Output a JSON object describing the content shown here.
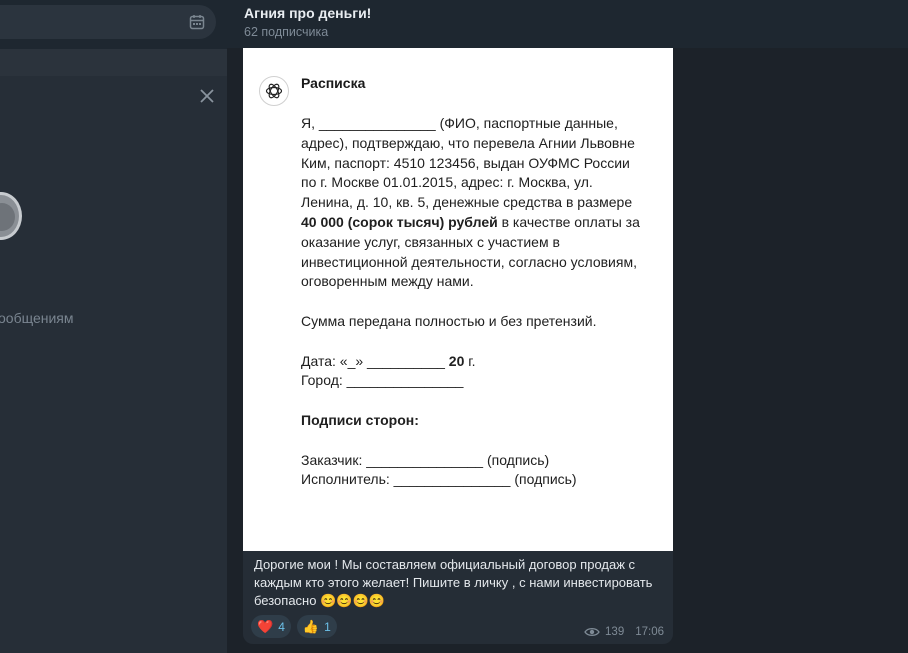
{
  "sidebar": {
    "partial_text": "ообщениям"
  },
  "channel": {
    "title": "Агния про деньги!",
    "subscribers": "62 подписчика"
  },
  "document": {
    "title": "Расписка",
    "paragraph1_pre": "Я, _______________ (ФИО, паспортные данные, адрес), подтверждаю, что перевела Агнии Львовне Ким, паспорт: 4510 123456, выдан ОУФМС России по г. Москве 01.01.2015, адрес: г. Москва, ул. Ленина, д. 10, кв. 5, денежные средства в размере ",
    "paragraph1_bold": "40 000 (сорок тысяч) рублей",
    "paragraph1_post": " в качестве оплаты за оказание услуг, связанных с участием в инвестиционной деятельности, согласно условиям, оговоренным между нами.",
    "paragraph2": "Сумма передана полностью и без претензий.",
    "date_label": "Дата: «_» __________ ",
    "date_bold": "20",
    "date_suffix": " г.",
    "city_line": "Город: _______________",
    "signatures_heading": "Подписи сторон:",
    "customer_line": "Заказчик: _______________ (подпись)",
    "executor_line": "Исполнитель: _______________ (подпись)"
  },
  "caption": {
    "text": "Дорогие мои ! Мы составляем официальный договор продаж с каждым кто этого желает! Пишите в личку , с нами инвестировать безопасно 😊😊😊😊"
  },
  "reactions": [
    {
      "emoji": "❤️",
      "count": "4"
    },
    {
      "emoji": "👍",
      "count": "1"
    }
  ],
  "meta": {
    "views": "139",
    "time": "17:06"
  },
  "icons": {
    "calendar": "calendar-icon",
    "close": "close-icon",
    "logo": "openai-logo-icon",
    "eye": "eye-icon",
    "forward": "forward-icon"
  }
}
